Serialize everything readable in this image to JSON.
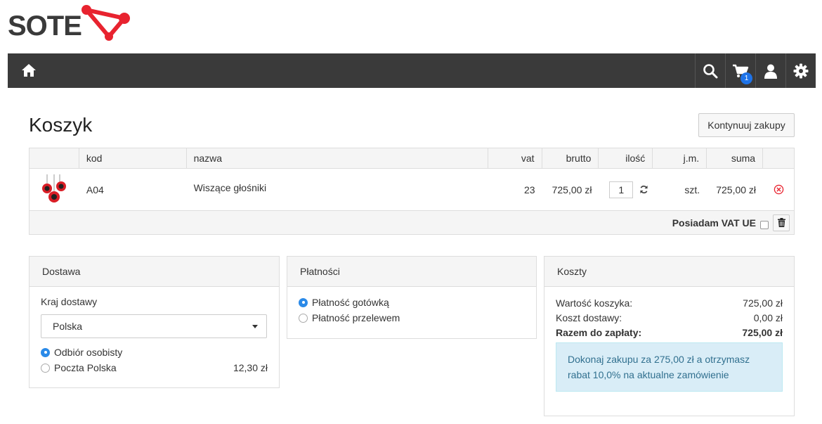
{
  "logo": {
    "text": "SOTE"
  },
  "navbar": {
    "icons": [
      "home-icon",
      "search-icon",
      "cart-icon",
      "user-icon",
      "gear-icon"
    ],
    "cart_count": "1",
    "background": "#3a3a3a"
  },
  "page": {
    "title": "Koszyk",
    "continue_button": "Kontynuuj zakupy"
  },
  "cart": {
    "headers": {
      "code": "kod",
      "name": "nazwa",
      "vat": "vat",
      "gross": "brutto",
      "qty": "ilość",
      "unit": "j.m.",
      "sum": "suma"
    },
    "items": [
      {
        "code": "A04",
        "name": "Wiszące głośniki",
        "vat": "23",
        "gross": "725,00 zł",
        "qty": "1",
        "unit": "szt.",
        "sum": "725,00 zł"
      }
    ],
    "vat_ue_label": "Posiadam VAT UE"
  },
  "delivery": {
    "title": "Dostawa",
    "country_label": "Kraj dostawy",
    "country_value": "Polska",
    "options": [
      {
        "label": "Odbiór osobisty",
        "price": "",
        "selected": true
      },
      {
        "label": "Poczta Polska",
        "price": "12,30 zł",
        "selected": false
      }
    ]
  },
  "payment": {
    "title": "Płatności",
    "options": [
      {
        "label": "Płatność gotówką",
        "selected": true
      },
      {
        "label": "Płatność przelewem",
        "selected": false
      }
    ]
  },
  "costs": {
    "title": "Koszty",
    "cart_value_label": "Wartość koszyka:",
    "cart_value": "725,00 zł",
    "delivery_label": "Koszt dostawy:",
    "delivery_value": "0,00 zł",
    "total_label": "Razem do zapłaty:",
    "total_value": "725,00 zł",
    "info": "Dokonaj zakupu za 275,00 zł a otrzymasz rabat 10,0% na aktualne zamówienie"
  },
  "colors": {
    "brand_red": "#e8232f",
    "accent_blue": "#2b8ae8",
    "info_bg": "#d9edf7"
  }
}
